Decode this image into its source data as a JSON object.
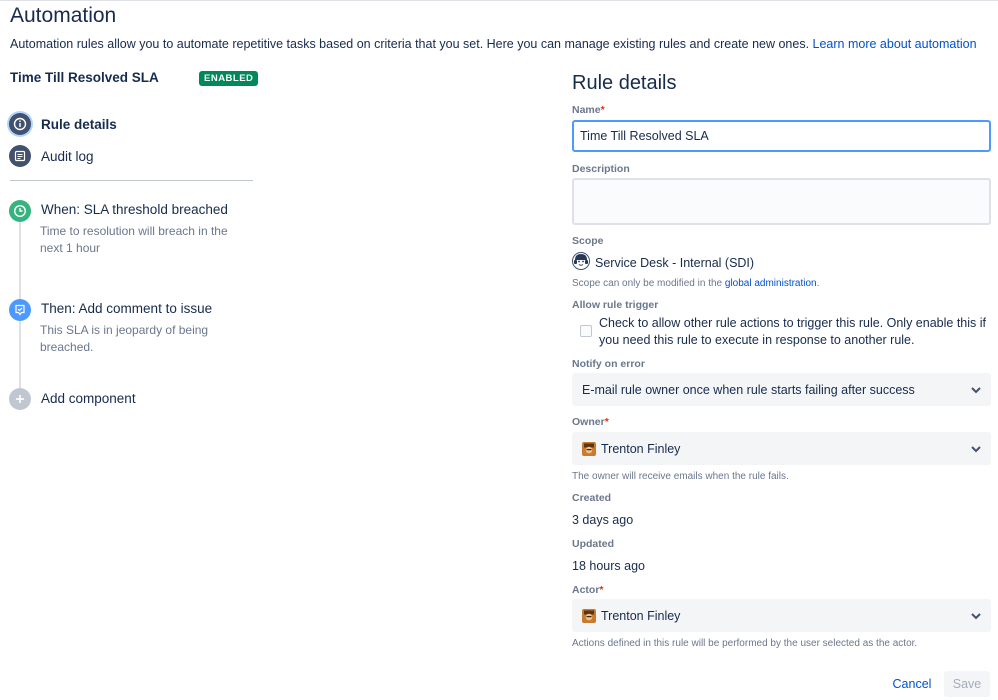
{
  "page": {
    "title": "Automation",
    "description": "Automation rules allow you to automate repetitive tasks based on criteria that you set. Here you can manage existing rules and create new ones. ",
    "learn_more_link": "Learn more about automation"
  },
  "rule": {
    "title": "Time Till Resolved SLA",
    "status": "ENABLED"
  },
  "nav": {
    "items": [
      {
        "label": "Rule details",
        "icon": "info-icon",
        "active": true
      },
      {
        "label": "Audit log",
        "icon": "list-icon",
        "active": false
      }
    ]
  },
  "components": [
    {
      "title": "When: SLA threshold breached",
      "description": "Time to resolution will breach in the next 1 hour",
      "icon": "clock-icon",
      "color": "#36b37e"
    },
    {
      "title": "Then: Add comment to issue",
      "description": "This SLA is in jeopardy of being breached.",
      "icon": "comment-icon",
      "color": "#4c9aff"
    },
    {
      "title": "Add component",
      "icon": "plus-icon",
      "color": "#c1c7d0"
    }
  ],
  "details": {
    "section_title": "Rule details",
    "name_label": "Name",
    "name_value": "Time Till Resolved SLA",
    "description_label": "Description",
    "description_value": "",
    "scope_label": "Scope",
    "scope_value": "Service Desk - Internal (SDI)",
    "scope_helper": "Scope can only be modified in the ",
    "scope_helper_link": "global administration",
    "scope_helper_end": ".",
    "allow_trigger_label": "Allow rule trigger",
    "allow_trigger_text": "Check to allow other rule actions to trigger this rule. Only enable this if you need this rule to execute in response to another rule.",
    "allow_trigger_checked": false,
    "notify_label": "Notify on error",
    "notify_value": "E-mail rule owner once when rule starts failing after success",
    "owner_label": "Owner",
    "owner_value": "Trenton Finley",
    "owner_helper": "The owner will receive emails when the rule fails.",
    "created_label": "Created",
    "created_value": "3 days ago",
    "updated_label": "Updated",
    "updated_value": "18 hours ago",
    "actor_label": "Actor",
    "actor_value": "Trenton Finley",
    "actor_helper": "Actions defined in this rule will be performed by the user selected as the actor.",
    "required_marker": "*"
  },
  "actions": {
    "cancel_label": "Cancel",
    "save_label": "Save"
  },
  "colors": {
    "accent": "#0052cc",
    "enabled_badge": "#00875a",
    "focus_border": "#4c9aff",
    "required": "#de350b"
  }
}
